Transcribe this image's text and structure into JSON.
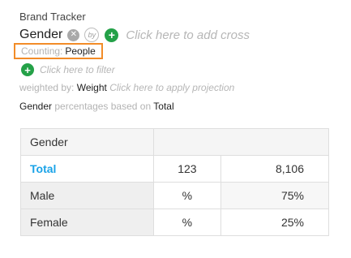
{
  "header": {
    "app_name": "Brand Tracker",
    "question": "Gender",
    "remove_icon": "x-icon",
    "by_label": "by",
    "add_icon": "plus-icon",
    "add_cross_hint": "Click here to add cross"
  },
  "counting": {
    "label": "Counting:",
    "value": "People"
  },
  "filter": {
    "hint": "Click here to filter"
  },
  "weight": {
    "label": "weighted by:",
    "value": "Weight",
    "hint": "Click here to apply projection"
  },
  "basis": {
    "question": "Gender",
    "text": "percentages based on",
    "value": "Total"
  },
  "table": {
    "header": {
      "label": "Gender",
      "col2": "",
      "col3": ""
    },
    "rows": [
      {
        "label": "Total",
        "stat": "123",
        "value": "8,106"
      },
      {
        "label": "Male",
        "stat": "%",
        "value": "75%"
      },
      {
        "label": "Female",
        "stat": "%",
        "value": "25%"
      }
    ]
  },
  "colors": {
    "accent_green": "#24a148",
    "highlight_orange": "#f28c28",
    "total_blue": "#1aa3e8"
  }
}
